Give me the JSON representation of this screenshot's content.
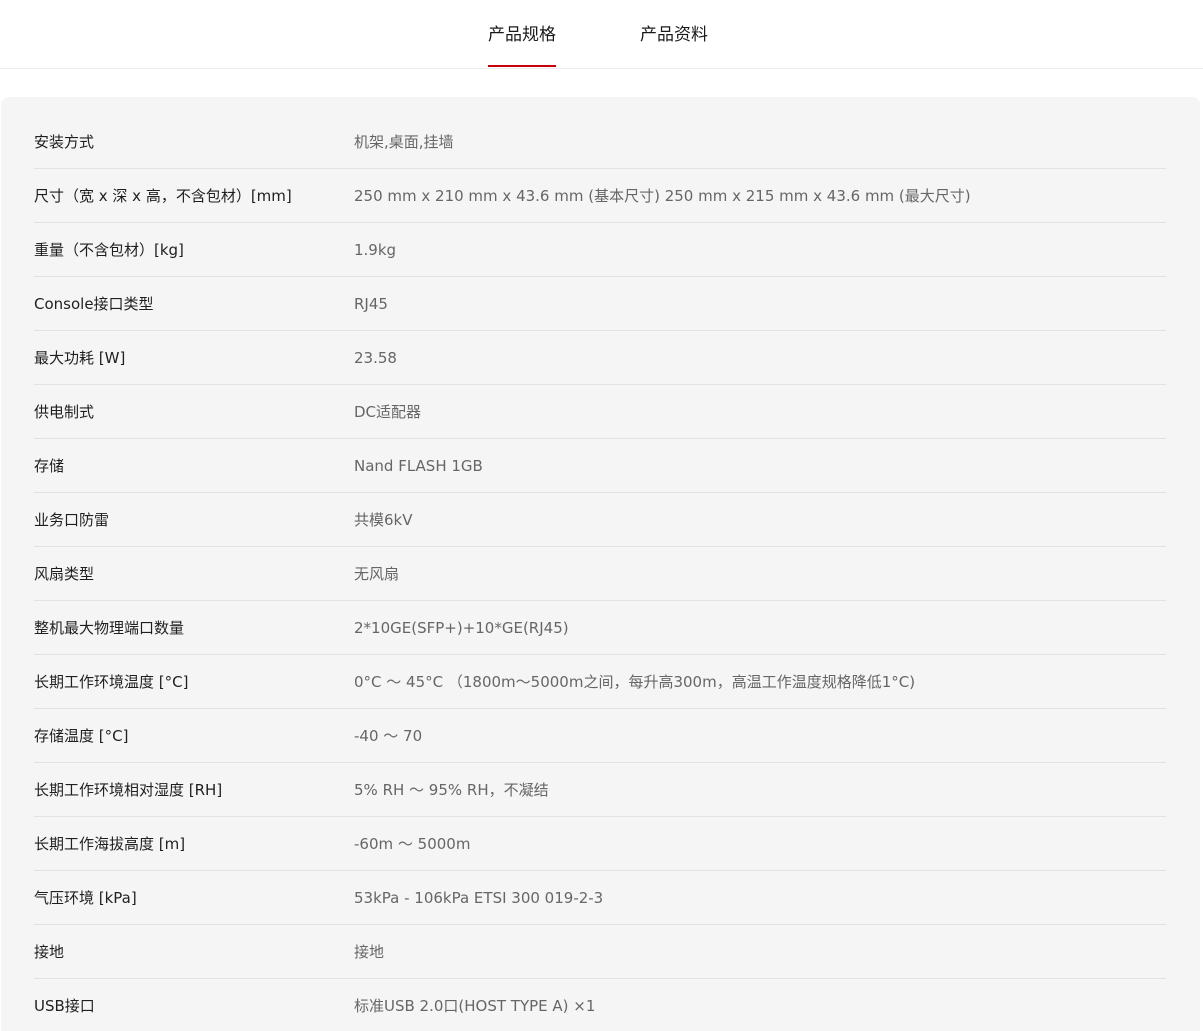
{
  "tabs": {
    "spec_label": "产品规格",
    "docs_label": "产品资料",
    "accent_color": "#c7000b"
  },
  "specs": [
    {
      "label": "安装方式",
      "value": "机架,桌面,挂墙"
    },
    {
      "label": "尺寸（宽 x 深 x 高，不含包材）[mm]",
      "value": "250 mm x 210 mm x 43.6 mm (基本尺寸) 250 mm x 215 mm x 43.6 mm (最大尺寸)"
    },
    {
      "label": "重量（不含包材）[kg]",
      "value": "1.9kg"
    },
    {
      "label": "Console接口类型",
      "value": "RJ45"
    },
    {
      "label": "最大功耗 [W]",
      "value": "23.58"
    },
    {
      "label": "供电制式",
      "value": "DC适配器"
    },
    {
      "label": "存储",
      "value": "Nand FLASH 1GB"
    },
    {
      "label": "业务口防雷",
      "value": "共模6kV"
    },
    {
      "label": "风扇类型",
      "value": "无风扇"
    },
    {
      "label": "整机最大物理端口数量",
      "value": "2*10GE(SFP+)+10*GE(RJ45)"
    },
    {
      "label": "长期工作环境温度 [°C]",
      "value": "0°C ～ 45°C （1800m～5000m之间，每升高300m，高温工作温度规格降低1°C)"
    },
    {
      "label": "存储温度 [°C]",
      "value": "-40 ～ 70"
    },
    {
      "label": "长期工作环境相对湿度 [RH]",
      "value": "5% RH ～ 95% RH，不凝结"
    },
    {
      "label": "长期工作海拔高度 [m]",
      "value": "-60m ～ 5000m"
    },
    {
      "label": "气压环境 [kPa]",
      "value": "53kPa - 106kPa ETSI 300 019-2-3"
    },
    {
      "label": "接地",
      "value": "接地"
    },
    {
      "label": "USB接口",
      "value": "标准USB 2.0口(HOST TYPE A) ×1"
    }
  ]
}
